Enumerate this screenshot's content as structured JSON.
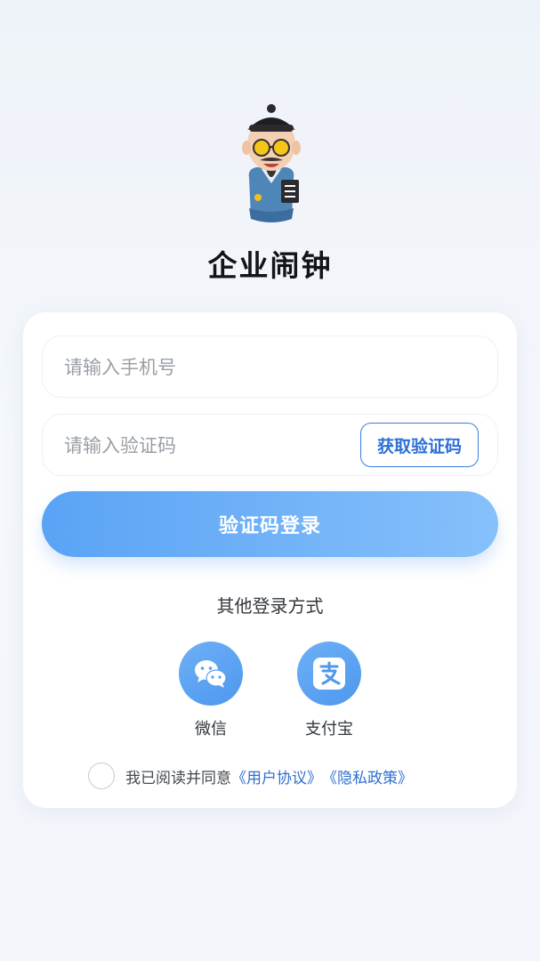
{
  "app": {
    "title": "企业闹钟"
  },
  "login": {
    "phone_placeholder": "请输入手机号",
    "code_placeholder": "请输入验证码",
    "get_code_label": "获取验证码",
    "submit_label": "验证码登录"
  },
  "other_login": {
    "title": "其他登录方式",
    "methods": [
      {
        "label": "微信",
        "icon": "wechat-icon"
      },
      {
        "label": "支付宝",
        "icon": "alipay-icon"
      }
    ]
  },
  "agreement": {
    "checked": false,
    "prefix": "我已阅读并同意",
    "user_agreement": "《用户协议》",
    "privacy_policy": "《隐私政策》"
  },
  "colors": {
    "accent": "#5aa3f5",
    "link": "#2f6fd0",
    "title": "#111418"
  }
}
